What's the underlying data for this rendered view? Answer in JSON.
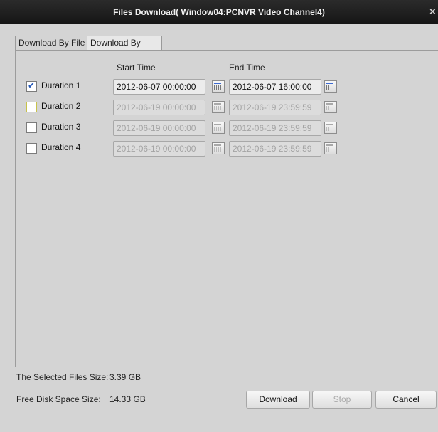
{
  "window": {
    "title": "Files Download( Window04:PCNVR Video Channel4)",
    "close": "×"
  },
  "tabs": [
    {
      "label": "Download By File"
    },
    {
      "label": "Download By Date"
    }
  ],
  "headers": {
    "start": "Start Time",
    "end": "End Time"
  },
  "rows": [
    {
      "label": "Duration 1",
      "checked": true,
      "start": "2012-06-07 00:00:00",
      "end": "2012-06-07 16:00:00"
    },
    {
      "label": "Duration 2",
      "checked": false,
      "start": "2012-06-19 00:00:00",
      "end": "2012-06-19 23:59:59"
    },
    {
      "label": "Duration 3",
      "checked": false,
      "start": "2012-06-19 00:00:00",
      "end": "2012-06-19 23:59:59"
    },
    {
      "label": "Duration 4",
      "checked": false,
      "start": "2012-06-19 00:00:00",
      "end": "2012-06-19 23:59:59"
    }
  ],
  "info": {
    "selected_label": "The Selected Files Size:",
    "selected_value": "3.39 GB",
    "free_label": "Free Disk Space Size:",
    "free_value": "14.33 GB"
  },
  "buttons": {
    "download": "Download",
    "stop": "Stop",
    "cancel": "Cancel"
  }
}
